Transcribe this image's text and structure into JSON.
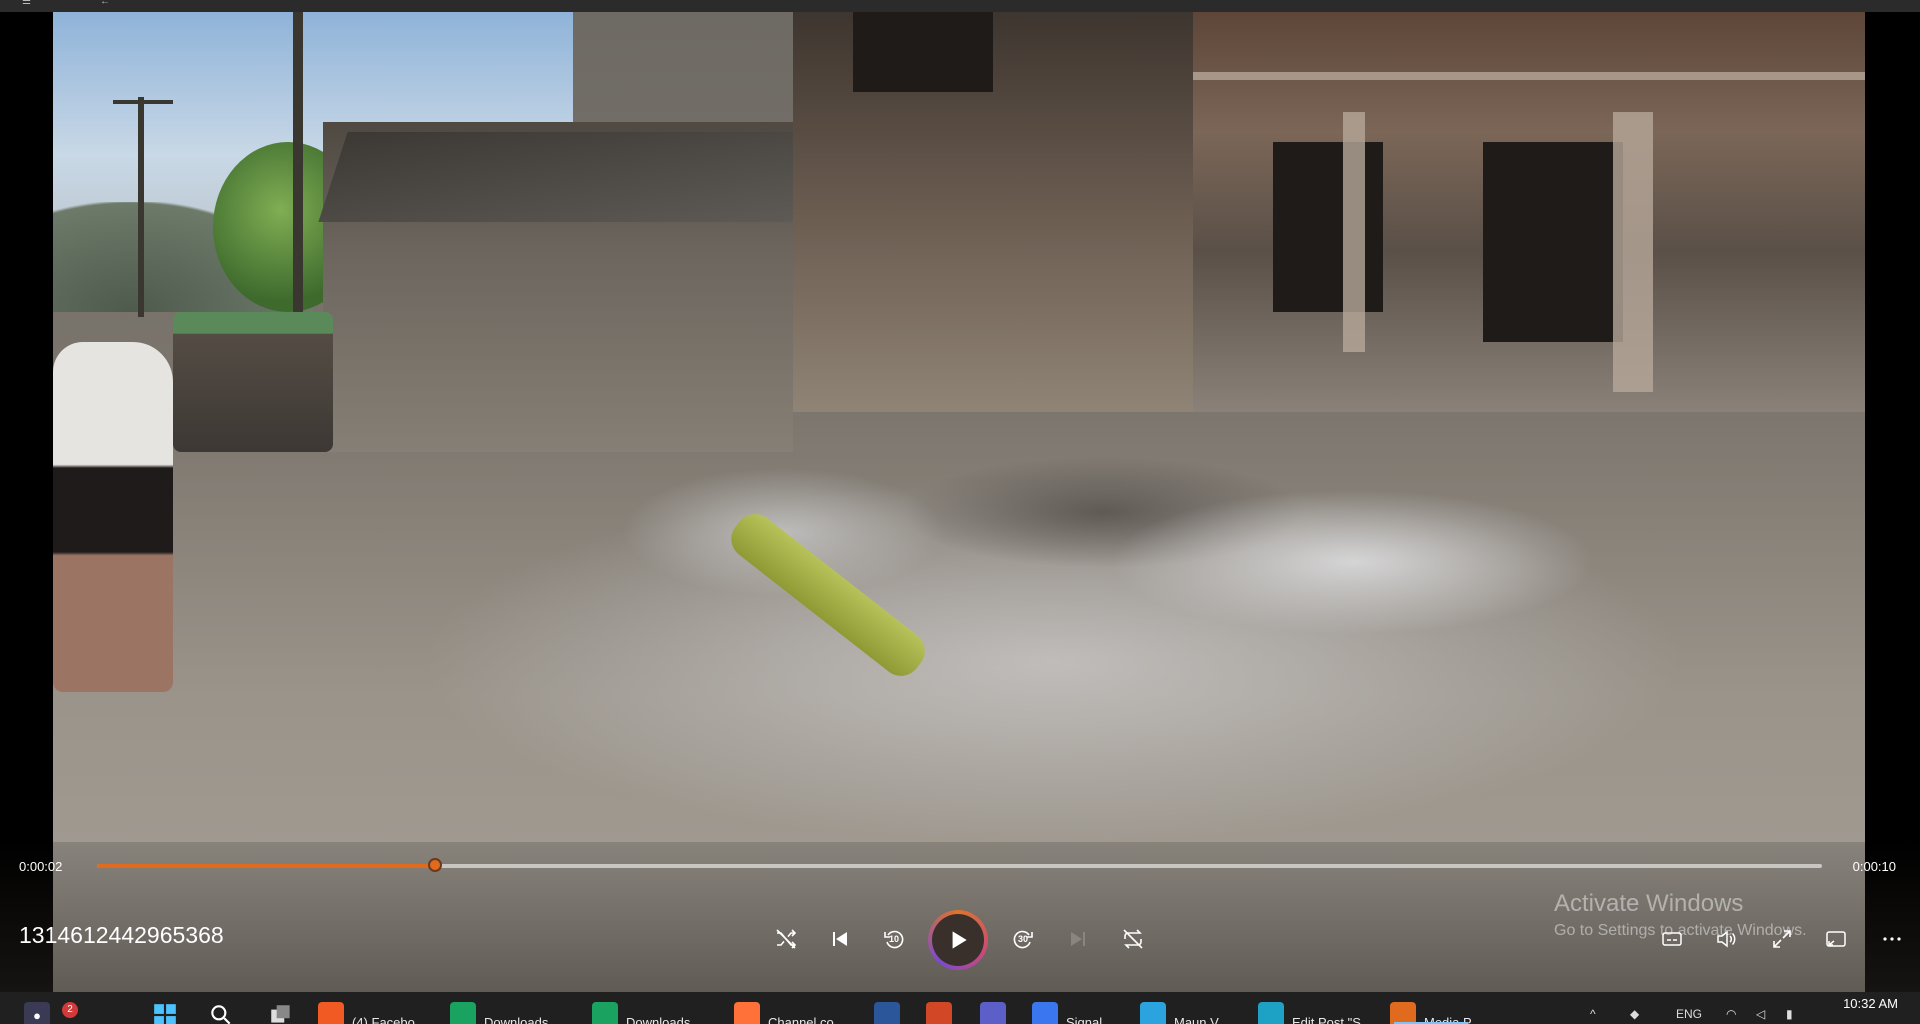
{
  "player": {
    "current_time": "0:00:02",
    "total_time": "0:00:10",
    "progress_fraction": 0.196,
    "title": "1314612442965368",
    "skip_back_seconds": "10",
    "skip_forward_seconds": "30",
    "accent_color": "#e06a1e"
  },
  "controls": {
    "shuffle_icon": "shuffle-icon",
    "previous_icon": "previous-icon",
    "rewind_icon": "rewind-10-icon",
    "play_icon": "play-icon",
    "forward_icon": "forward-30-icon",
    "next_icon": "next-icon",
    "repeat_icon": "repeat-off-icon",
    "subtitles_icon": "subtitles-icon",
    "volume_icon": "volume-icon",
    "fullscreen_icon": "fullscreen-icon",
    "miniplayer_icon": "miniplayer-icon",
    "more_icon": "more-icon"
  },
  "watermark": {
    "title": "Activate Windows",
    "subtitle": "Go to Settings to activate Windows."
  },
  "taskbar": {
    "badge_count": "2",
    "items": [
      {
        "label": "(4) Facebo",
        "icon": "brave-icon",
        "color": "#f15a22"
      },
      {
        "label": "Downloads",
        "icon": "folder-icon",
        "color": "#1aa260"
      },
      {
        "label": "Downloads",
        "icon": "folder-icon",
        "color": "#1aa260"
      },
      {
        "label": "Channel co",
        "icon": "firefox-icon",
        "color": "#ff7139"
      },
      {
        "label": "",
        "icon": "word-icon",
        "color": "#2b579a"
      },
      {
        "label": "",
        "icon": "powerpoint-icon",
        "color": "#d24726"
      },
      {
        "label": "",
        "icon": "teams-icon",
        "color": "#5b5fc7"
      },
      {
        "label": "Signal",
        "icon": "signal-icon",
        "color": "#3a76f0"
      },
      {
        "label": "Maun V",
        "icon": "telegram-icon",
        "color": "#2aa3df"
      },
      {
        "label": "Edit Post \"S",
        "icon": "edge-icon",
        "color": "#1da1c4"
      },
      {
        "label": "Media P",
        "icon": "media-player-icon",
        "color": "#e06a1e"
      }
    ],
    "language": "ENG",
    "time": "10:32 AM"
  }
}
